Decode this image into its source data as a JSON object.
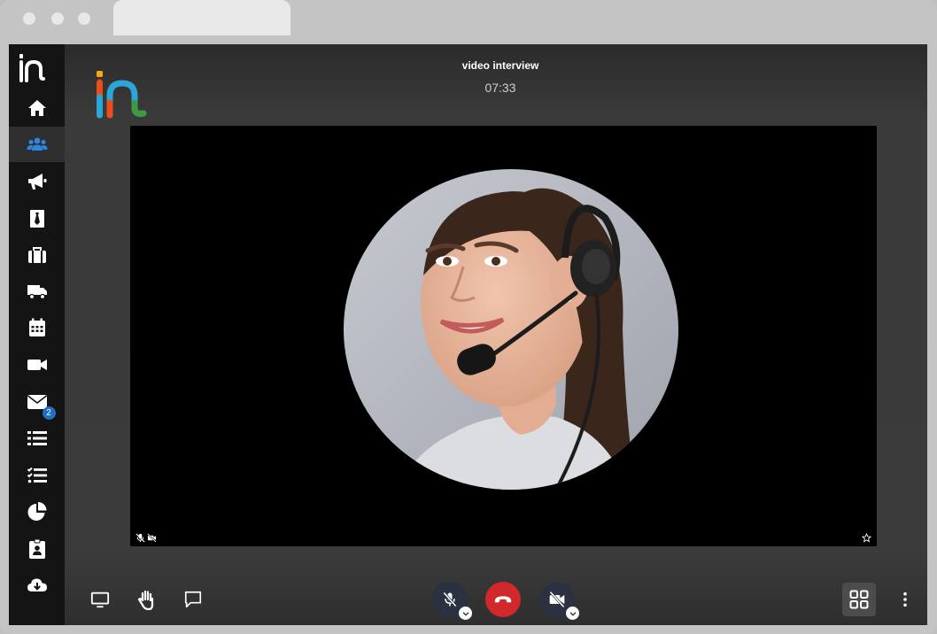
{
  "call": {
    "title": "video interview",
    "timer": "07:33"
  },
  "sidebar": {
    "active_index": 1,
    "items": [
      {
        "icon": "home-icon"
      },
      {
        "icon": "users-icon"
      },
      {
        "icon": "megaphone-icon"
      },
      {
        "icon": "tie-icon"
      },
      {
        "icon": "briefcase-icon"
      },
      {
        "icon": "truck-icon"
      },
      {
        "icon": "calendar-icon"
      },
      {
        "icon": "video-camera-icon"
      },
      {
        "icon": "envelope-icon",
        "badge": "2"
      },
      {
        "icon": "list-icon"
      },
      {
        "icon": "tasks-icon"
      },
      {
        "icon": "pie-chart-icon"
      },
      {
        "icon": "id-badge-icon"
      },
      {
        "icon": "cloud-download-icon"
      }
    ]
  },
  "toolbar": {
    "left": [
      "screen-share-icon",
      "raise-hand-icon",
      "chat-icon"
    ],
    "center": [
      "microphone-muted-icon",
      "hang-up-icon",
      "camera-off-icon"
    ],
    "right": [
      "tile-view-icon",
      "more-options-icon"
    ]
  },
  "colors": {
    "sidebar_bg": "#141414",
    "hangup_red": "#d2272b",
    "round_button_bg": "#2b3140",
    "badge_blue": "#1e6fc4",
    "logo_colors": [
      "#e94e1b",
      "#f3a712",
      "#2aa6d8",
      "#3d9a3f"
    ]
  }
}
